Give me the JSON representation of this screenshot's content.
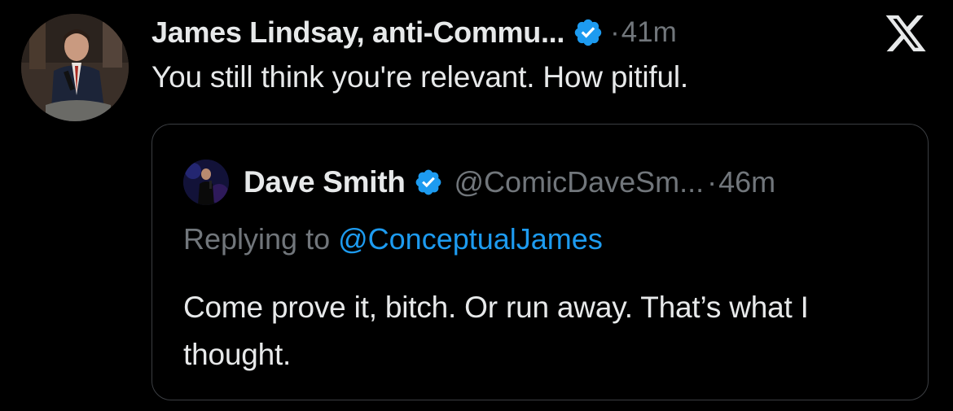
{
  "tweet": {
    "display_name": "James Lindsay, anti-Commu...",
    "verified": true,
    "separator": "·",
    "time": "41m",
    "text": "You still think you're relevant. How pitiful."
  },
  "quoted_tweet": {
    "display_name": "Dave Smith",
    "verified": true,
    "handle": "@ComicDaveSm...",
    "separator": "·",
    "time": "46m",
    "replying_prefix": "Replying to ",
    "replying_handle": "@ConceptualJames",
    "text": "Come prove it, bitch. Or run away. That’s what I thought."
  },
  "icons": {
    "verified_badge": "verified-badge-icon",
    "brand": "x-logo-icon"
  },
  "colors": {
    "background": "#000000",
    "primary_text": "#e7e9ea",
    "secondary_text": "#71767b",
    "accent": "#1d9bf0",
    "border": "#3b3e42"
  }
}
